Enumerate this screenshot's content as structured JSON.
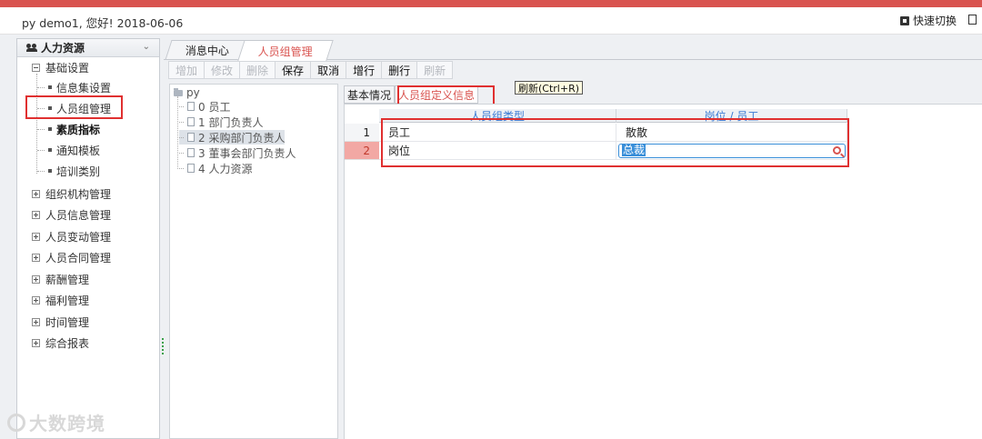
{
  "header": {
    "welcome": "py demo1, 您好! 2018-06-06",
    "quick_switch": "快速切换"
  },
  "sidebar": {
    "module_title": "人力资源",
    "basic_settings": "基础设置",
    "basic_items": [
      {
        "label": "信息集设置"
      },
      {
        "label": "人员组管理"
      },
      {
        "label": "素质指标"
      },
      {
        "label": "通知模板"
      },
      {
        "label": "培训类别"
      }
    ],
    "groups": [
      {
        "label": "组织机构管理"
      },
      {
        "label": "人员信息管理"
      },
      {
        "label": "人员变动管理"
      },
      {
        "label": "人员合同管理"
      },
      {
        "label": "薪酬管理"
      },
      {
        "label": "福利管理"
      },
      {
        "label": "时间管理"
      },
      {
        "label": "综合报表"
      }
    ]
  },
  "tabs": [
    {
      "label": "消息中心"
    },
    {
      "label": "人员组管理"
    }
  ],
  "toolbar": {
    "buttons": [
      {
        "label": "增加"
      },
      {
        "label": "修改"
      },
      {
        "label": "删除"
      },
      {
        "label": "保存"
      },
      {
        "label": "取消"
      },
      {
        "label": "增行"
      },
      {
        "label": "删行"
      },
      {
        "label": "刷新"
      }
    ],
    "tooltip": "刷新(Ctrl+R)"
  },
  "tree": {
    "root": "py",
    "items": [
      {
        "label": "0 员工"
      },
      {
        "label": "1 部门负责人"
      },
      {
        "label": "2 采购部门负责人"
      },
      {
        "label": "3 董事会部门负责人"
      },
      {
        "label": "4 人力资源"
      }
    ]
  },
  "subtabs": [
    {
      "label": "基本情况"
    },
    {
      "label": "人员组定义信息"
    }
  ],
  "grid": {
    "columns": [
      "人员组类型",
      "岗位 / 员工"
    ],
    "rows": [
      {
        "num": "1",
        "type": "员工",
        "value": "散散"
      },
      {
        "num": "2",
        "type": "岗位",
        "value": "总裁"
      }
    ]
  },
  "watermark": "大数跨境",
  "colors": {
    "accent_red": "#d9534f",
    "highlight_blue": "#3a8fd9",
    "annotation_red": "#e03030"
  }
}
